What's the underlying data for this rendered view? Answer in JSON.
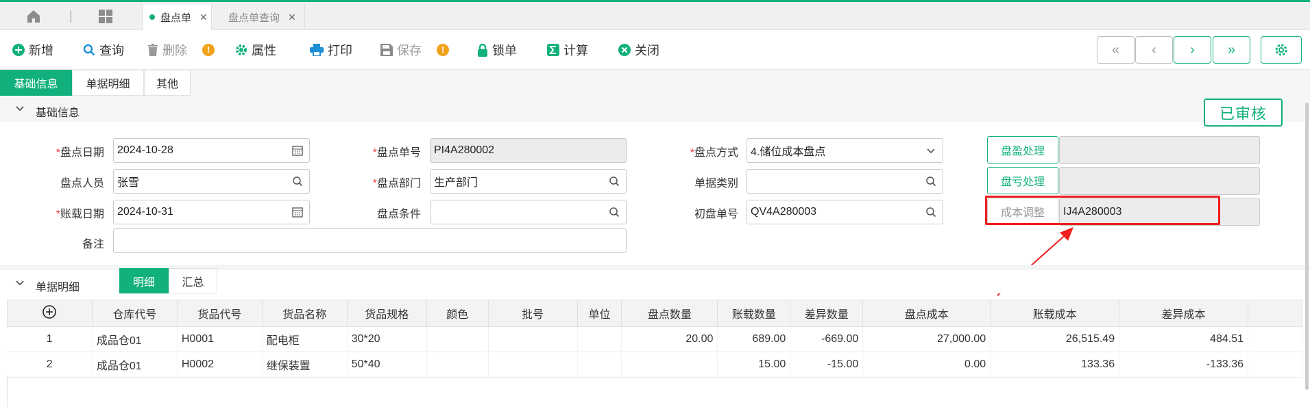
{
  "tabs": {
    "items": [
      {
        "label": "盘点单",
        "active": true
      },
      {
        "label": "盘点单查询",
        "active": false
      }
    ]
  },
  "toolbar": {
    "add": "新增",
    "query": "查询",
    "delete": "删除",
    "props": "属性",
    "print": "打印",
    "save": "保存",
    "lock": "锁单",
    "calc": "计算",
    "close": "关闭",
    "warn": "!"
  },
  "subtabs": [
    "基础信息",
    "单据明细",
    "其他"
  ],
  "basic": {
    "section_title": "基础信息",
    "status_stamp": "已审核",
    "inventory_date": {
      "label": "盘点日期",
      "value": "2024-10-28"
    },
    "inventory_no": {
      "label": "盘点单号",
      "value": "PI4A280002"
    },
    "method": {
      "label": "盘点方式",
      "value": "4.储位成本盘点"
    },
    "person": {
      "label": "盘点人员",
      "value": "张雪"
    },
    "dept": {
      "label": "盘点部门",
      "value": "生产部门"
    },
    "doc_type": {
      "label": "单据类别",
      "value": ""
    },
    "book_date": {
      "label": "账载日期",
      "value": "2024-10-31"
    },
    "condition": {
      "label": "盘点条件",
      "value": ""
    },
    "first_no": {
      "label": "初盘单号",
      "value": "QV4A280003"
    },
    "remark": {
      "label": "备注",
      "value": ""
    },
    "surplus_btn": "盘盈处理",
    "loss_btn": "盘亏处理",
    "cost_btn": "成本调整",
    "surplus_value": "",
    "loss_value": "",
    "cost_value": "IJ4A280003"
  },
  "detail": {
    "section_title": "单据明细",
    "views": [
      "明细",
      "汇总"
    ],
    "columns": [
      "仓库代号",
      "货品代号",
      "货品名称",
      "货品规格",
      "颜色",
      "批号",
      "单位",
      "盘点数量",
      "账载数量",
      "差异数量",
      "盘点成本",
      "账载成本",
      "差异成本"
    ],
    "rows": [
      [
        "1",
        "成品仓01",
        "H0001",
        "配电柜",
        "30*20",
        "",
        "",
        "",
        "20.00",
        "689.00",
        "-669.00",
        "27,000.00",
        "26,515.49",
        "484.51"
      ],
      [
        "2",
        "成品仓01",
        "H0002",
        "继保装置",
        "50*40",
        "",
        "",
        "",
        "",
        "15.00",
        "-15.00",
        "0.00",
        "133.36",
        "-133.36"
      ]
    ]
  },
  "colors": {
    "accent": "#11b07d",
    "highlight": "#f01e1e",
    "warning": "#f0a21a"
  }
}
